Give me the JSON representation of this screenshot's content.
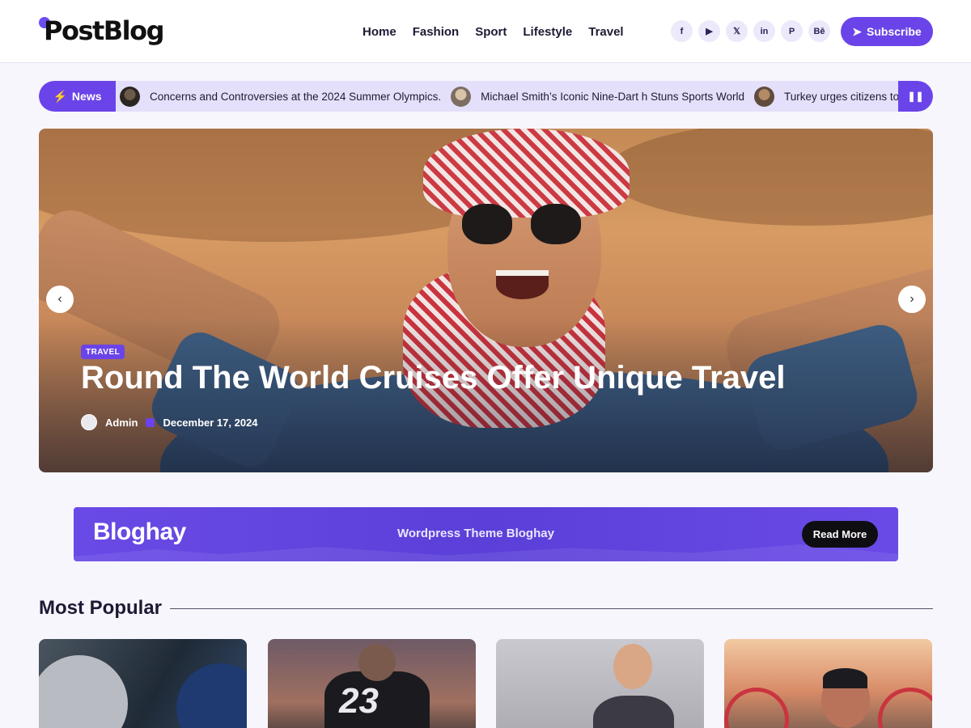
{
  "header": {
    "logo": "PostBlog",
    "nav": [
      "Home",
      "Fashion",
      "Sport",
      "Lifestyle",
      "Travel"
    ],
    "socials": [
      {
        "icon": "facebook-icon",
        "glyph": "f"
      },
      {
        "icon": "youtube-icon",
        "glyph": "▶"
      },
      {
        "icon": "x-icon",
        "glyph": "𝕏"
      },
      {
        "icon": "linkedin-icon",
        "glyph": "in"
      },
      {
        "icon": "pinterest-icon",
        "glyph": "P"
      },
      {
        "icon": "behance-icon",
        "glyph": "Bē"
      }
    ],
    "subscribe_label": "Subscribe"
  },
  "ticker": {
    "badge": "News",
    "items": [
      "Concerns and Controversies at the 2024 Summer Olympics.",
      "Michael Smith’s Iconic Nine-Dart h Stuns Sports World",
      "Turkey urges citizens to"
    ]
  },
  "hero": {
    "category": "TRAVEL",
    "title": "Round The World Cruises Offer Unique Travel",
    "author": "Admin",
    "date": "December 17, 2024"
  },
  "banner": {
    "logo": "Bloghay",
    "text": "Wordpress Theme Bloghay",
    "button": "Read More"
  },
  "popular": {
    "title": "Most Popular",
    "card_jersey_number": "23"
  },
  "colors": {
    "accent": "#6a44e8",
    "ticker_bg": "#e4e0fb",
    "page_bg": "#f7f6fd"
  }
}
